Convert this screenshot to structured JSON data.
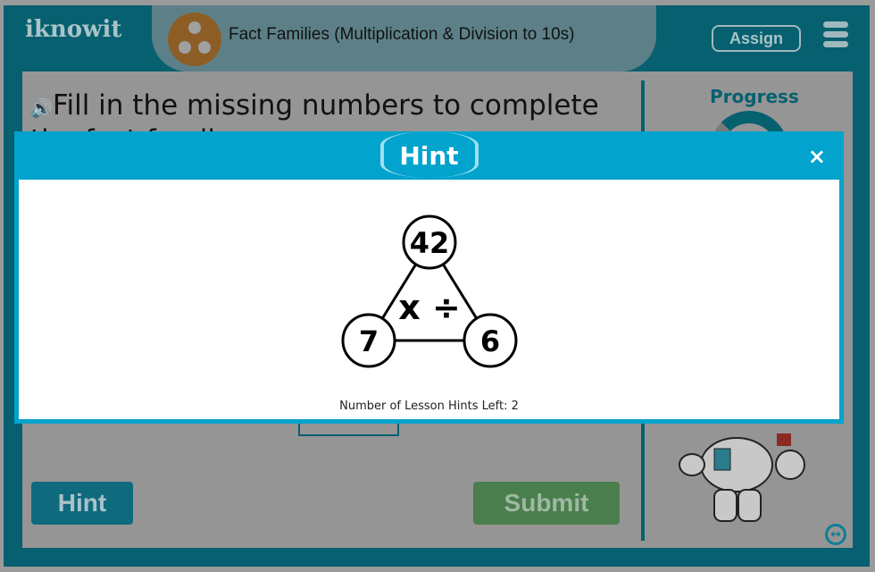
{
  "header": {
    "logo": "iknowit",
    "topic_title": "Fact Families (Multiplication & Division to 10s)",
    "assign_label": "Assign",
    "menu_icon": "hamburger-icon"
  },
  "question": {
    "text": "Fill in the missing numbers to complete the fact family:",
    "audio_icon": "speaker-icon"
  },
  "sidebar": {
    "progress_label": "Progress"
  },
  "buttons": {
    "hint": "Hint",
    "submit": "Submit"
  },
  "modal": {
    "title": "Hint",
    "close": "×",
    "triangle": {
      "top": "42",
      "left": "7",
      "right": "6",
      "operators": "x ÷"
    },
    "hints_left": "Number of Lesson Hints Left: 2"
  },
  "colors": {
    "frame": "#07606f",
    "modal": "#02a3cc",
    "submit": "#4a7e4c"
  }
}
